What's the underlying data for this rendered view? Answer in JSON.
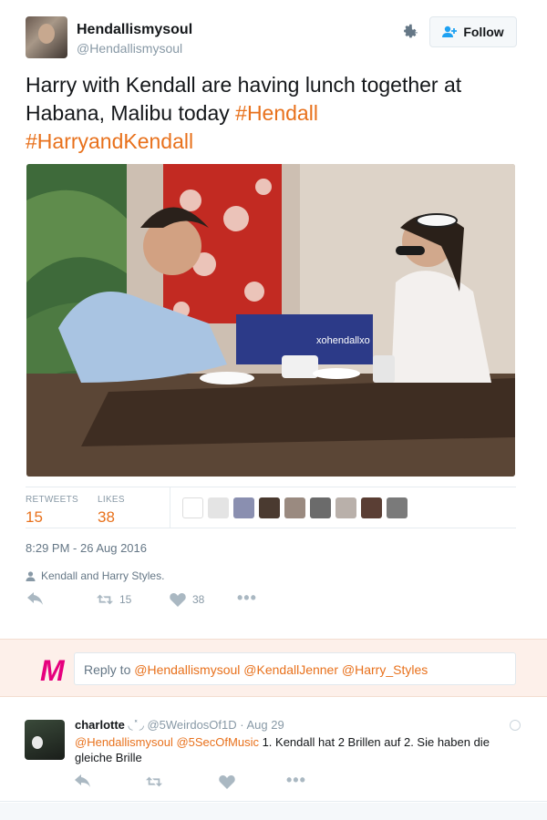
{
  "tweet": {
    "display_name": "Hendallismysoul",
    "handle": "@Hendallismysoul",
    "follow_label": "Follow",
    "text_plain": "Harry with Kendall are having lunch together at Habana, Malibu today ",
    "hashtags": [
      "#Hendall",
      "#HarryandKendall"
    ],
    "photo_caption": "xohendallxo",
    "stats": {
      "retweets_label": "RETWEETS",
      "retweets_value": "15",
      "likes_label": "LIKES",
      "likes_value": "38"
    },
    "liker_icon": "avatar-thumbnail",
    "timestamp": "8:29 PM - 26 Aug 2016",
    "location": "Kendall and Harry Styles.",
    "actions": {
      "reply_icon": "reply-icon",
      "retweet_icon": "retweet-icon",
      "retweet_count": "15",
      "like_icon": "heart-icon",
      "like_count": "38",
      "more_icon": "more-icon"
    }
  },
  "reply_box": {
    "logo_letter": "M",
    "prefix": "Reply to ",
    "mentions": "@Hendallismysoul @KendallJenner @Harry_Styles"
  },
  "reply_tweet": {
    "name": "charlotte",
    "name_deco": " ◟ ̽ ◞",
    "handle": "@5WeirdosOf1D",
    "separator": " · ",
    "date": "Aug 29",
    "mentions": "@Hendallismysoul @5SecOfMusic",
    "text": " 1. Kendall hat 2 Brillen auf 2. Sie haben die gleiche Brille"
  },
  "colors": {
    "accent": "#e8711c",
    "muted": "#8899a6",
    "reply_bg": "#fdf0ea",
    "logo": "#e6007e"
  }
}
